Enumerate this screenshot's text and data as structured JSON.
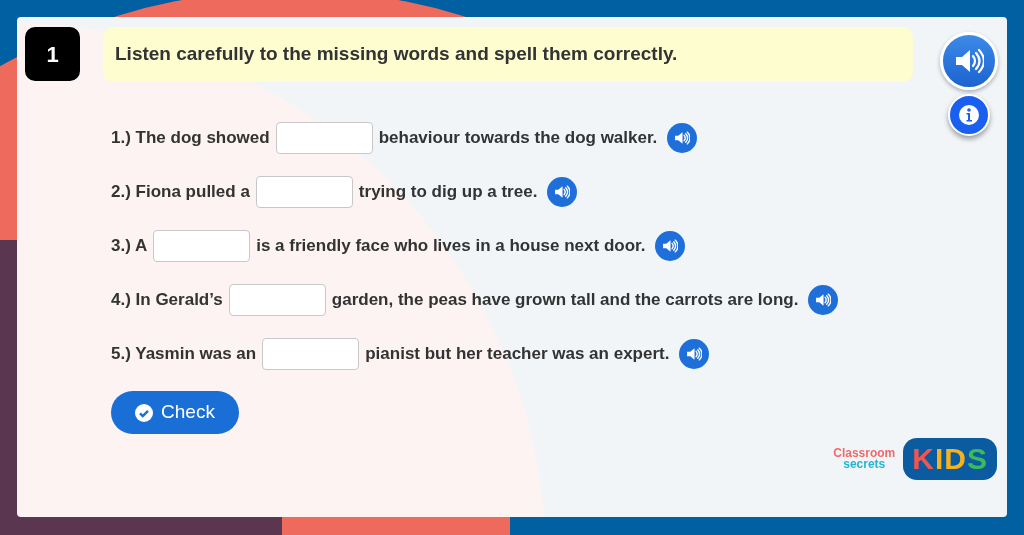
{
  "question": {
    "number": "1",
    "prompt": "Listen carefully to the missing words and spell them correctly."
  },
  "sentences": [
    {
      "before": "1.) The dog showed",
      "after": "behaviour towards the dog walker."
    },
    {
      "before": "2.) Fiona pulled a",
      "after": "trying to dig up a tree."
    },
    {
      "before": "3.) A",
      "after": "is a friendly face who lives in a house next door."
    },
    {
      "before": "4.) In Gerald’s",
      "after": "garden, the peas have grown tall and the carrots are long."
    },
    {
      "before": "5.) Yasmin was an",
      "after": "pianist but her teacher was an expert."
    }
  ],
  "check_button": {
    "label": "Check"
  },
  "logo": {
    "brand_top": "Classroom",
    "brand_bottom": "secrets",
    "badge": "KIDS"
  }
}
